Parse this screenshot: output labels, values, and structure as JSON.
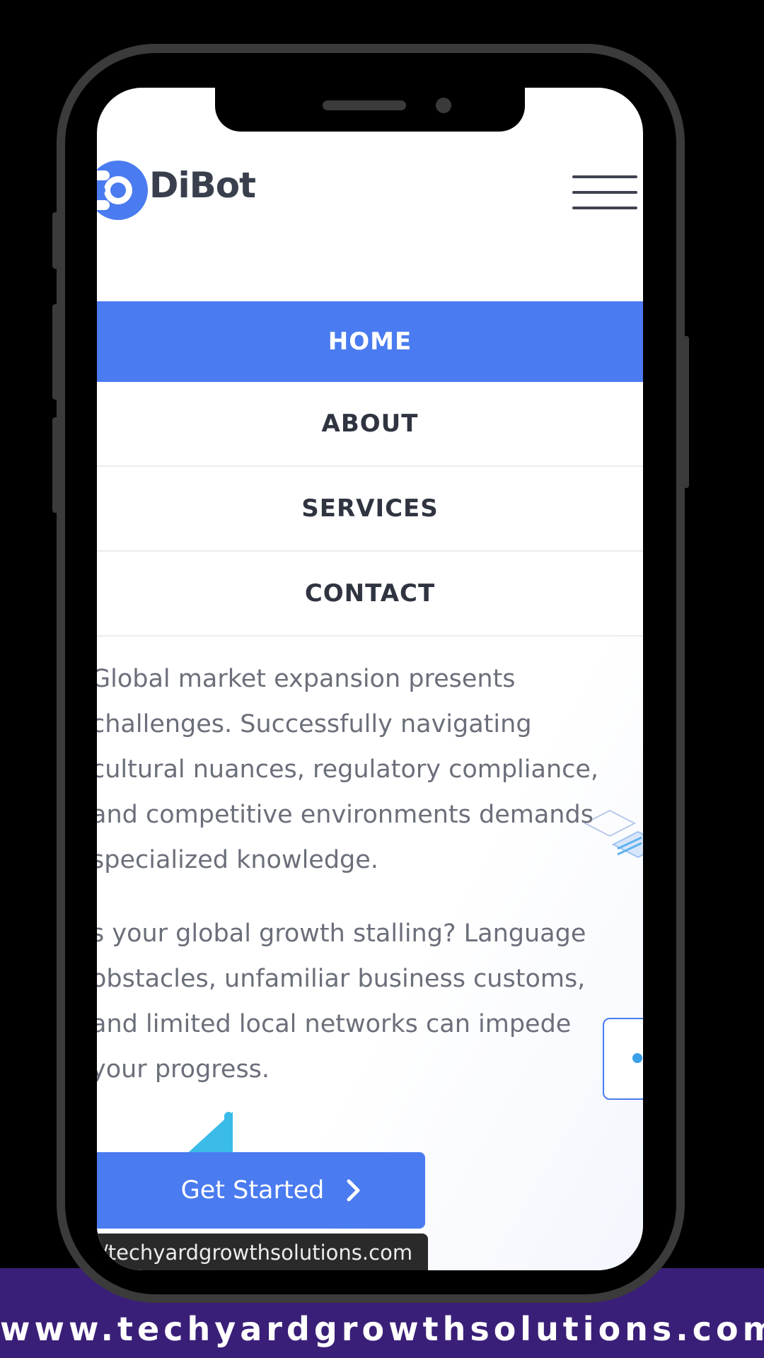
{
  "brand": {
    "name": "DiBot",
    "accent": "#4a7bf0"
  },
  "nav": {
    "items": [
      {
        "label": "HOME",
        "active": true
      },
      {
        "label": "ABOUT",
        "active": false
      },
      {
        "label": "SERVICES",
        "active": false
      },
      {
        "label": "CONTACT",
        "active": false
      }
    ]
  },
  "content": {
    "paragraph1": "Global market expansion presents\nchallenges. Successfully navigating\ncultural nuances, regulatory compliance,\nand competitive environments demands\nspecialized knowledge.",
    "paragraph2": "s your global growth stalling? Language\nobstacles, unfamiliar business customs,\nand limited local networks can impede\nyour progress."
  },
  "cta": {
    "label": "Get Started",
    "icon": "chevron-right-icon"
  },
  "status_url": "/techyardgrowthsolutions.com",
  "footer": {
    "url": "www.techyardgrowthsolutions.com",
    "background": "#3a1f78"
  },
  "icons": {
    "menu": "hamburger-menu-icon",
    "logo": "dibot-logo-mark"
  }
}
